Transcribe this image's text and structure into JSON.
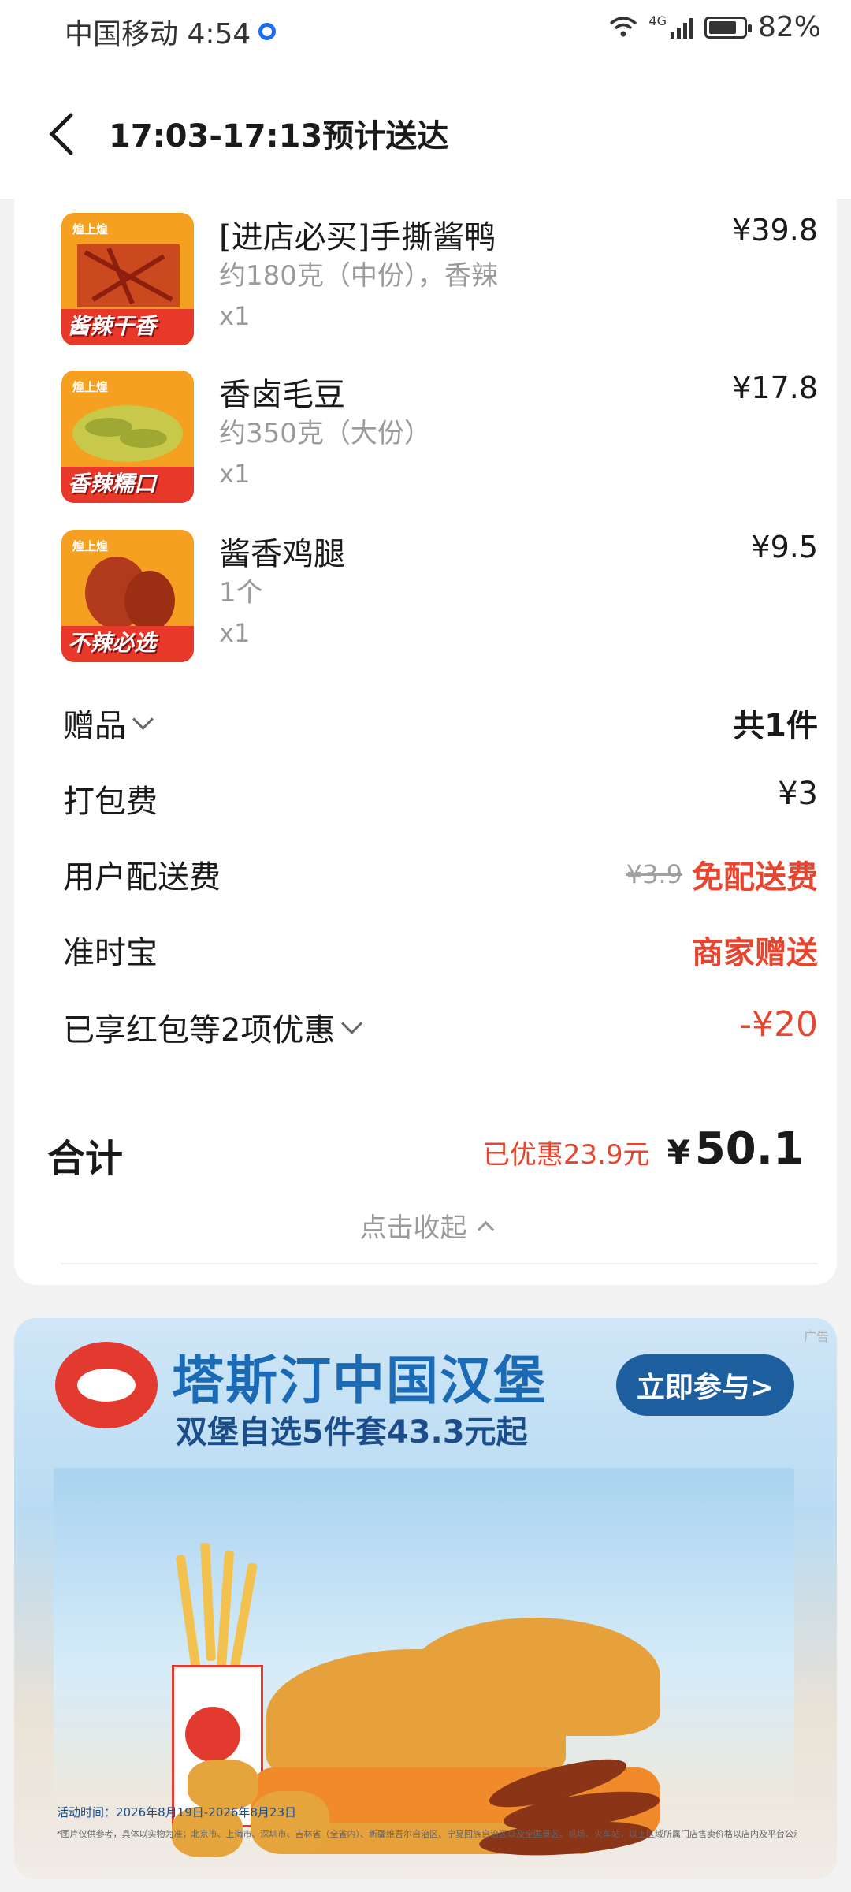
{
  "status_bar": {
    "carrier_time": "中国移动 4:54",
    "network": "4G",
    "battery": "82%",
    "battery_level": 0.82
  },
  "header": {
    "title": "17:03-17:13预计送达"
  },
  "items": [
    {
      "name": "[进店必买]手撕酱鸭",
      "spec": "约180克（中份），香辣",
      "qty": "x1",
      "price": "¥39.8",
      "thumb_brand": "煌上煌",
      "thumb_tag": "酱辣干香"
    },
    {
      "name": "香卤毛豆",
      "spec": "约350克（大份）",
      "qty": "x1",
      "price": "¥17.8",
      "thumb_brand": "煌上煌",
      "thumb_tag": "香辣糯口"
    },
    {
      "name": "酱香鸡腿",
      "spec": "1个",
      "qty": "x1",
      "price": "¥9.5",
      "thumb_brand": "煌上煌",
      "thumb_tag": "不辣必选"
    }
  ],
  "fees": {
    "gift_label": "赠品",
    "gift_value": "共1件",
    "packing_label": "打包费",
    "packing_value": "¥3",
    "delivery_label": "用户配送费",
    "delivery_original": "¥3.9",
    "delivery_value": "免配送费",
    "ontime_label": "准时宝",
    "ontime_value": "商家赠送",
    "discount_label": "已享红包等2项优惠",
    "discount_value": "-¥20"
  },
  "total": {
    "label": "合计",
    "saved": "已优惠23.9元",
    "currency": "¥",
    "amount": "50.1"
  },
  "collapse_label": "点击收起",
  "ad": {
    "corner": "广告",
    "title": "塔斯汀中国汉堡",
    "subtitle": "双堡自选5件套43.3元起",
    "cta": "立即参与>",
    "date": "活动时间：2026年8月19日-2026年8月23日",
    "fine_print": "*图片仅供参考，具体以实物为准；北京市、上海市、深圳市、吉林省（全省内）、新疆维吾尔自治区、宁夏回族自治区以及全国景区、机场、火车站，以上区域所属门店售卖价格以店内及平台公示为准；具体详见套餐页下方规则说明。"
  }
}
